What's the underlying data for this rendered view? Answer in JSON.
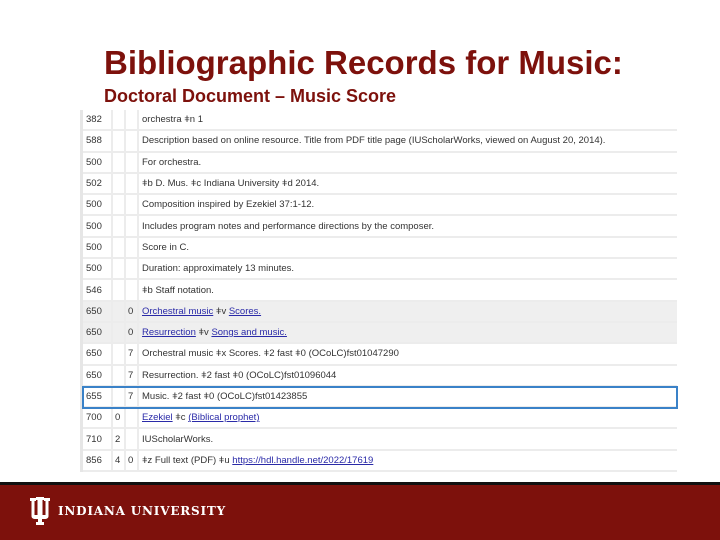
{
  "slide": {
    "title": "Bibliographic Records for Music:",
    "subtitle": "Doctoral Document – Music Score"
  },
  "marc_rows": [
    {
      "tag": "382",
      "ind1": "",
      "ind2": "",
      "text": "orchestra ǂn 1"
    },
    {
      "tag": "588",
      "ind1": "",
      "ind2": "",
      "text": "Description based on online resource. Title from PDF title page (IUScholarWorks, viewed on August 20, 2014)."
    },
    {
      "tag": "500",
      "ind1": "",
      "ind2": "",
      "text": "For orchestra."
    },
    {
      "tag": "502",
      "ind1": "",
      "ind2": "",
      "text": "ǂb D. Mus. ǂc Indiana University ǂd 2014."
    },
    {
      "tag": "500",
      "ind1": "",
      "ind2": "",
      "text": "Composition inspired by Ezekiel 37:1-12."
    },
    {
      "tag": "500",
      "ind1": "",
      "ind2": "",
      "text": "Includes program notes and performance directions by the composer."
    },
    {
      "tag": "500",
      "ind1": "",
      "ind2": "",
      "text": "Score in C."
    },
    {
      "tag": "500",
      "ind1": "",
      "ind2": "",
      "text": "Duration: approximately 13 minutes."
    },
    {
      "tag": "546",
      "ind1": "",
      "ind2": "",
      "text": "ǂb Staff notation."
    },
    {
      "tag": "650",
      "ind1": "",
      "ind2": "0",
      "link1": "Orchestral music",
      "mid": " ǂv ",
      "link2": "Scores."
    },
    {
      "tag": "650",
      "ind1": "",
      "ind2": "0",
      "link1": "Resurrection",
      "mid": " ǂv ",
      "link2": "Songs and music."
    },
    {
      "tag": "650",
      "ind1": "",
      "ind2": "7",
      "text": "Orchestral music ǂx Scores. ǂ2 fast ǂ0 (OCoLC)fst01047290"
    },
    {
      "tag": "650",
      "ind1": "",
      "ind2": "7",
      "text": "Resurrection. ǂ2 fast ǂ0 (OCoLC)fst01096044"
    },
    {
      "tag": "655",
      "ind1": "",
      "ind2": "7",
      "text": "Music. ǂ2 fast ǂ0 (OCoLC)fst01423855"
    },
    {
      "tag": "700",
      "ind1": "0",
      "ind2": "",
      "link1": "Ezekiel",
      "mid": " ǂc ",
      "link2": "(Biblical prophet)"
    },
    {
      "tag": "710",
      "ind1": "2",
      "ind2": "",
      "text": "IUScholarWorks."
    },
    {
      "tag": "856",
      "ind1": "4",
      "ind2": "0",
      "pre": "ǂz Full text (PDF) ǂu ",
      "link1": "https://hdl.handle.net/2022/17619"
    }
  ],
  "footer": {
    "university": "INDIANA UNIVERSITY"
  },
  "colors": {
    "brand": "#7d110c",
    "selection": "#3a82c8",
    "link": "#2a2aa8"
  }
}
